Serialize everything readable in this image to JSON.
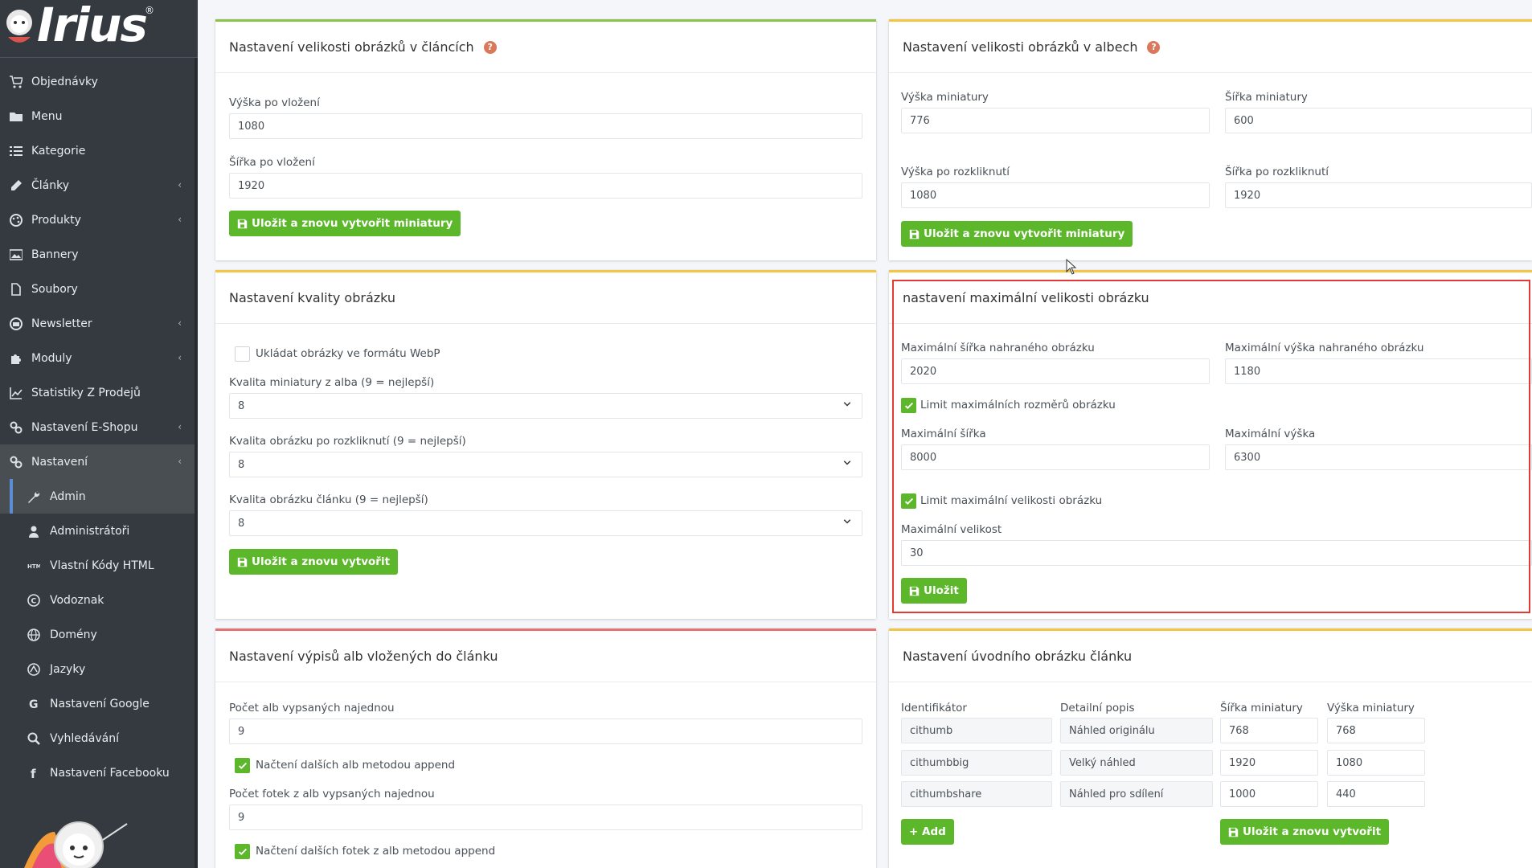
{
  "brand": {
    "logo_text": "Irius",
    "reg": "®"
  },
  "sidebar": {
    "items": [
      {
        "label": "Objednávky",
        "icon": "cart-icon",
        "chevron": false
      },
      {
        "label": "Menu",
        "icon": "folder-icon",
        "chevron": false
      },
      {
        "label": "Kategorie",
        "icon": "list-icon",
        "chevron": false
      },
      {
        "label": "Články",
        "icon": "pencil-icon",
        "chevron": true
      },
      {
        "label": "Produkty",
        "icon": "palette-icon",
        "chevron": true
      },
      {
        "label": "Bannery",
        "icon": "image-icon",
        "chevron": false
      },
      {
        "label": "Soubory",
        "icon": "file-icon",
        "chevron": false
      },
      {
        "label": "Newsletter",
        "icon": "newsletter-icon",
        "chevron": true
      },
      {
        "label": "Moduly",
        "icon": "puzzle-icon",
        "chevron": true
      },
      {
        "label": "Statistiky Z Prodejů",
        "icon": "chart-icon",
        "chevron": false
      },
      {
        "label": "Nastavení E-Shopu",
        "icon": "gears-icon",
        "chevron": true
      },
      {
        "label": "Nastavení",
        "icon": "gears-icon",
        "chevron": true
      }
    ],
    "subitems": [
      {
        "label": "Admin",
        "icon": "wrench-icon"
      },
      {
        "label": "Administrátoři",
        "icon": "user-icon"
      },
      {
        "label": "Vlastní Kódy HTML",
        "icon": "html-icon"
      },
      {
        "label": "Vodoznak",
        "icon": "copyright-icon"
      },
      {
        "label": "Domény",
        "icon": "globe-icon"
      },
      {
        "label": "Jazyky",
        "icon": "language-icon"
      },
      {
        "label": "Nastavení Google",
        "icon": "google-icon"
      },
      {
        "label": "Vyhledávání",
        "icon": "search-icon"
      },
      {
        "label": "Nastavení Facebooku",
        "icon": "facebook-icon"
      }
    ]
  },
  "articles_size": {
    "title": "Nastavení velikosti obrázků v článcích",
    "height_label": "Výška po vložení",
    "height_value": "1080",
    "width_label": "Šířka po vložení",
    "width_value": "1920",
    "button": "Uložit a znovu vytvořit miniatury"
  },
  "albums_size": {
    "title": "Nastavení velikosti obrázků v albech",
    "thumb_height_label": "Výška miniatury",
    "thumb_height_value": "776",
    "thumb_width_label": "Šířka miniatury",
    "thumb_width_value": "600",
    "open_height_label": "Výška po rozkliknutí",
    "open_height_value": "1080",
    "open_width_label": "Šířka po rozkliknutí",
    "open_width_value": "1920",
    "button": "Uložit a znovu vytvořit miniatury"
  },
  "quality": {
    "title": "Nastavení kvality obrázku",
    "webp_label": "Ukládat obrázky ve formátu WebP",
    "webp_checked": false,
    "album_thumb_label": "Kvalita miniatury z alba (9 = nejlepší)",
    "album_thumb_value": "8",
    "open_label": "Kvalita obrázku po rozkliknutí (9 = nejlepší)",
    "open_value": "8",
    "article_label": "Kvalita obrázku článku (9 = nejlepší)",
    "article_value": "8",
    "button": "Uložit a znovu vytvořit"
  },
  "max_size": {
    "title": "nastavení maximální velikosti obrázku",
    "upload_width_label": "Maximální šířka nahraného obrázku",
    "upload_width_value": "2020",
    "upload_height_label": "Maximální výška nahraného obrázku",
    "upload_height_value": "1180",
    "limit_dims_label": "Limit maximálních rozměrů obrázku",
    "max_width_label": "Maximální šířka",
    "max_width_value": "8000",
    "max_height_label": "Maximální výška",
    "max_height_value": "6300",
    "limit_size_label": "Limit maximální velikosti obrázku",
    "max_size_label": "Maximální velikost",
    "max_size_value": "30",
    "button": "Uložit"
  },
  "album_listing": {
    "title": "Nastavení výpisů alb vložených do článku",
    "count_label": "Počet alb vypsaných najednou",
    "count_value": "9",
    "append_albums_label": "Načtení dalších alb metodou append",
    "photos_label": "Počet fotek z alb vypsaných najednou",
    "photos_value": "9",
    "append_photos_label": "Načtení dalších fotek z alb metodou append"
  },
  "intro_image": {
    "title": "Nastavení úvodního obrázku článku",
    "headers": [
      "Identifikátor",
      "Detailní popis",
      "Šířka miniatury",
      "Výška miniatury"
    ],
    "rows": [
      [
        "cithumb",
        "Náhled originálu",
        "768",
        "768"
      ],
      [
        "cithumbbig",
        "Velký náhled",
        "1920",
        "1080"
      ],
      [
        "cithumbshare",
        "Náhled pro sdílení",
        "1000",
        "440"
      ]
    ],
    "add_button": "+ Add",
    "save_button": "Uložit a znovu vytvořit"
  },
  "colors": {
    "accent_green": "#5cb82a",
    "highlight_red": "#e53935",
    "sidebar_bg": "#343a40"
  }
}
